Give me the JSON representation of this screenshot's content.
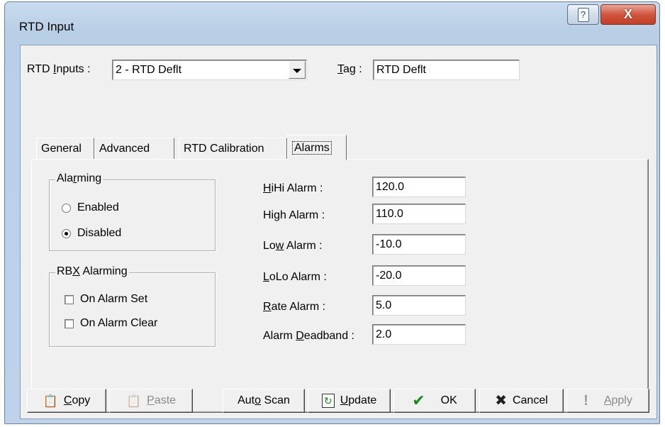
{
  "window": {
    "title": "RTD Input"
  },
  "title_bar": {
    "help_glyph": "?",
    "close_glyph": "X"
  },
  "header": {
    "rtd_inputs_label_pre": "RTD ",
    "rtd_inputs_label_u": "I",
    "rtd_inputs_label_post": "nputs :",
    "rtd_inputs_value": "2 - RTD Deflt",
    "tag_label_u": "T",
    "tag_label_post": "ag :",
    "tag_value": "RTD Deflt"
  },
  "tabs": [
    {
      "label": "General"
    },
    {
      "label": "Advanced"
    },
    {
      "label": "RTD Calibration"
    },
    {
      "label": "Alarms",
      "active": true
    }
  ],
  "alarming": {
    "title_pre": "Ala",
    "title_u": "r",
    "title_post": "ming",
    "enabled_label": "Enabled",
    "disabled_label": "Disabled",
    "selected": "Disabled"
  },
  "rbx_alarming": {
    "title_pre": "RB",
    "title_u": "X",
    "title_post": " Alarming",
    "on_set_label": "On Alarm Set",
    "on_clear_label": "On Alarm Clear",
    "on_set_checked": false,
    "on_clear_checked": false
  },
  "alarm_fields": {
    "hihi": {
      "label_u": "H",
      "label_post": "iHi Alarm :",
      "value": "120.0"
    },
    "high": {
      "label": "High Alarm :",
      "value": "110.0"
    },
    "low": {
      "label_pre": "Lo",
      "label_u": "w",
      "label_post": " Alarm :",
      "value": "-10.0"
    },
    "lolo": {
      "label_u": "L",
      "label_post": "oLo Alarm :",
      "value": "-20.0"
    },
    "rate": {
      "label_u": "R",
      "label_post": "ate Alarm :",
      "value": "5.0"
    },
    "deadband": {
      "label_pre": "Alarm ",
      "label_u": "D",
      "label_post": "eadband :",
      "value": "2.0"
    }
  },
  "buttons": {
    "copy": {
      "u": "C",
      "post": "opy",
      "icon": "copy-icon"
    },
    "paste": {
      "u": "P",
      "post": "aste",
      "icon": "paste-icon",
      "disabled": true
    },
    "auto_scan": {
      "pre": "Aut",
      "u": "o",
      "post": " Scan"
    },
    "update": {
      "u": "U",
      "post": "pdate",
      "icon": "refresh-icon"
    },
    "ok": {
      "label": "OK",
      "icon": "checkmark-icon",
      "icon_color": "#1a8a1a"
    },
    "cancel": {
      "label": "Cancel",
      "icon": "x-mark-icon",
      "icon_color": "#202020"
    },
    "apply": {
      "u": "A",
      "post": "pply",
      "icon": "exclamation-icon",
      "disabled": true
    }
  }
}
